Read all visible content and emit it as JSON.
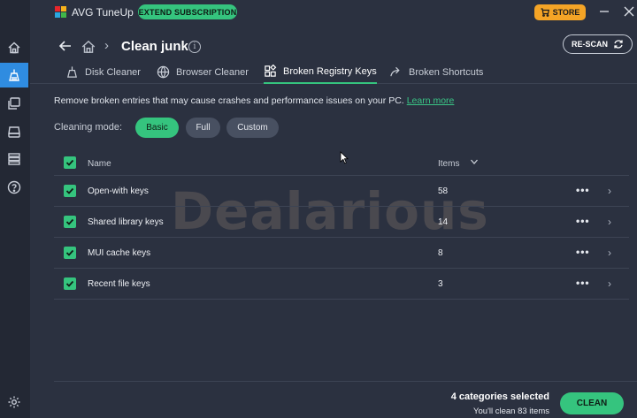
{
  "colors": {
    "accent_green": "#35c47e",
    "store_orange": "#f4a426",
    "nav_active_blue": "#2f8ce0",
    "background": "#2b3140"
  },
  "app": {
    "title": "AVG TuneUp",
    "extend_label": "EXTEND SUBSCRIPTION",
    "store_label": "STORE"
  },
  "sidebar": [
    {
      "icon": "home-icon"
    },
    {
      "icon": "broom-icon",
      "active": true
    },
    {
      "icon": "layers-icon"
    },
    {
      "icon": "drive-icon"
    },
    {
      "icon": "list-icon"
    },
    {
      "icon": "help-icon"
    },
    {
      "icon": "settings-icon"
    }
  ],
  "header": {
    "title": "Clean junk",
    "rescan_label": "RE-SCAN"
  },
  "tabs": [
    {
      "label": "Disk Cleaner",
      "icon": "broom-icon"
    },
    {
      "label": "Browser Cleaner",
      "icon": "globe-icon"
    },
    {
      "label": "Broken Registry Keys",
      "icon": "blocks-icon",
      "active": true
    },
    {
      "label": "Broken Shortcuts",
      "icon": "shortcut-arrow-icon"
    }
  ],
  "description": {
    "text": "Remove broken entries that may cause crashes and performance issues on your PC.",
    "link": "Learn more"
  },
  "cleaning_mode": {
    "label": "Cleaning mode:",
    "options": [
      "Basic",
      "Full",
      "Custom"
    ],
    "selected": "Basic"
  },
  "table": {
    "headers": {
      "name": "Name",
      "items": "Items"
    },
    "rows": [
      {
        "name": "Open-with keys",
        "items": "58",
        "checked": true
      },
      {
        "name": "Shared library keys",
        "items": "14",
        "checked": true
      },
      {
        "name": "MUI cache keys",
        "items": "8",
        "checked": true
      },
      {
        "name": "Recent file keys",
        "items": "3",
        "checked": true
      }
    ]
  },
  "watermark": "Dealarious",
  "footer": {
    "selected_text": "4 categories selected",
    "sub_text": "You'll clean 83 items",
    "clean_label": "CLEAN"
  }
}
